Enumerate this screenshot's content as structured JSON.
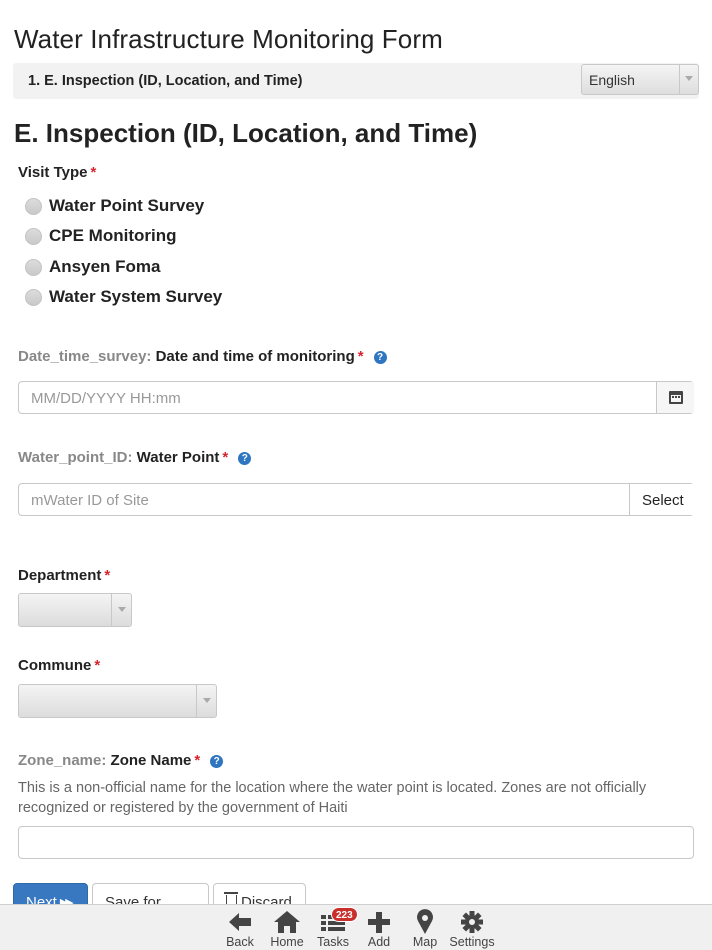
{
  "form": {
    "title": "Water Infrastructure Monitoring Form",
    "section_label": "1. E. Inspection (ID, Location, and Time)",
    "language": "English",
    "section_heading": "E. Inspection (ID, Location, and Time)"
  },
  "visit_type": {
    "label": "Visit Type",
    "required": "*",
    "options": [
      "Water Point Survey",
      "CPE Monitoring",
      "Ansyen Foma",
      "Water System Survey"
    ]
  },
  "date_time": {
    "code": "Date_time_survey:",
    "label": "Date and time of monitoring",
    "required": "*",
    "placeholder": "MM/DD/YYYY HH:mm",
    "help": "?"
  },
  "water_point": {
    "code": "Water_point_ID:",
    "label": "Water Point",
    "required": "*",
    "placeholder": "mWater ID of Site",
    "select_label": "Select",
    "help": "?"
  },
  "department": {
    "label": "Department",
    "required": "*"
  },
  "commune": {
    "label": "Commune",
    "required": "*"
  },
  "zone_name": {
    "code": "Zone_name:",
    "label": "Zone Name",
    "required": "*",
    "hint": "This is a non-official name for the location where the water point is located. Zones are not officially recognized or registered by the government of Haiti",
    "help": "?"
  },
  "buttons": {
    "next": "Next",
    "save_later": "Save for Later",
    "discard": "Discard"
  },
  "navbar": {
    "items": [
      {
        "label": "Back",
        "icon": "back-arrow-icon"
      },
      {
        "label": "Home",
        "icon": "home-icon"
      },
      {
        "label": "Tasks",
        "icon": "tasks-list-icon",
        "badge": "223"
      },
      {
        "label": "Add",
        "icon": "plus-icon"
      },
      {
        "label": "Map",
        "icon": "map-pin-icon"
      },
      {
        "label": "Settings",
        "icon": "gear-icon"
      }
    ]
  },
  "colors": {
    "accent": "#3778c0",
    "required": "#d9232d",
    "badge": "#c9302c",
    "help": "#2e76c1"
  }
}
